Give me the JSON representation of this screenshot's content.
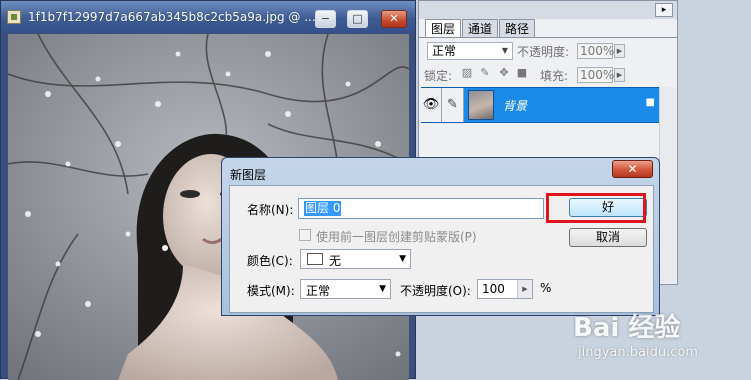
{
  "document": {
    "title": "1f1b7f12997d7a667ab345b8c2cb5a9a.jpg @ ...",
    "minimize": "−",
    "maximize": "□",
    "close": "✕"
  },
  "layers_panel": {
    "menu": "▸",
    "tabs": [
      "图层",
      "通道",
      "路径"
    ],
    "blend_mode": "正常",
    "opacity_label": "不透明度:",
    "opacity_value": "100%",
    "lock_label": "锁定:",
    "fill_label": "填充:",
    "fill_value": "100%",
    "layer": {
      "name": "背景"
    }
  },
  "dialog": {
    "title": "新图层",
    "close_glyph": "✕",
    "name_label": "名称(N):",
    "name_value": "图层 0",
    "clip_label": "使用前一图层创建剪贴蒙版(P)",
    "color_label": "颜色(C):",
    "color_value": "无",
    "mode_label": "模式(M):",
    "mode_value": "正常",
    "opacity_label": "不透明度(O):",
    "opacity_value": "100",
    "opacity_unit": "%",
    "ok_label": "好",
    "cancel_label": "取消"
  },
  "watermark": {
    "brand": "Bai 经验",
    "url": "jingyan.baidu.com"
  },
  "colors": {
    "selected_layer": "#1c8ae8",
    "highlight_box": "#e0141e",
    "titlebar": "#3e5b92"
  }
}
